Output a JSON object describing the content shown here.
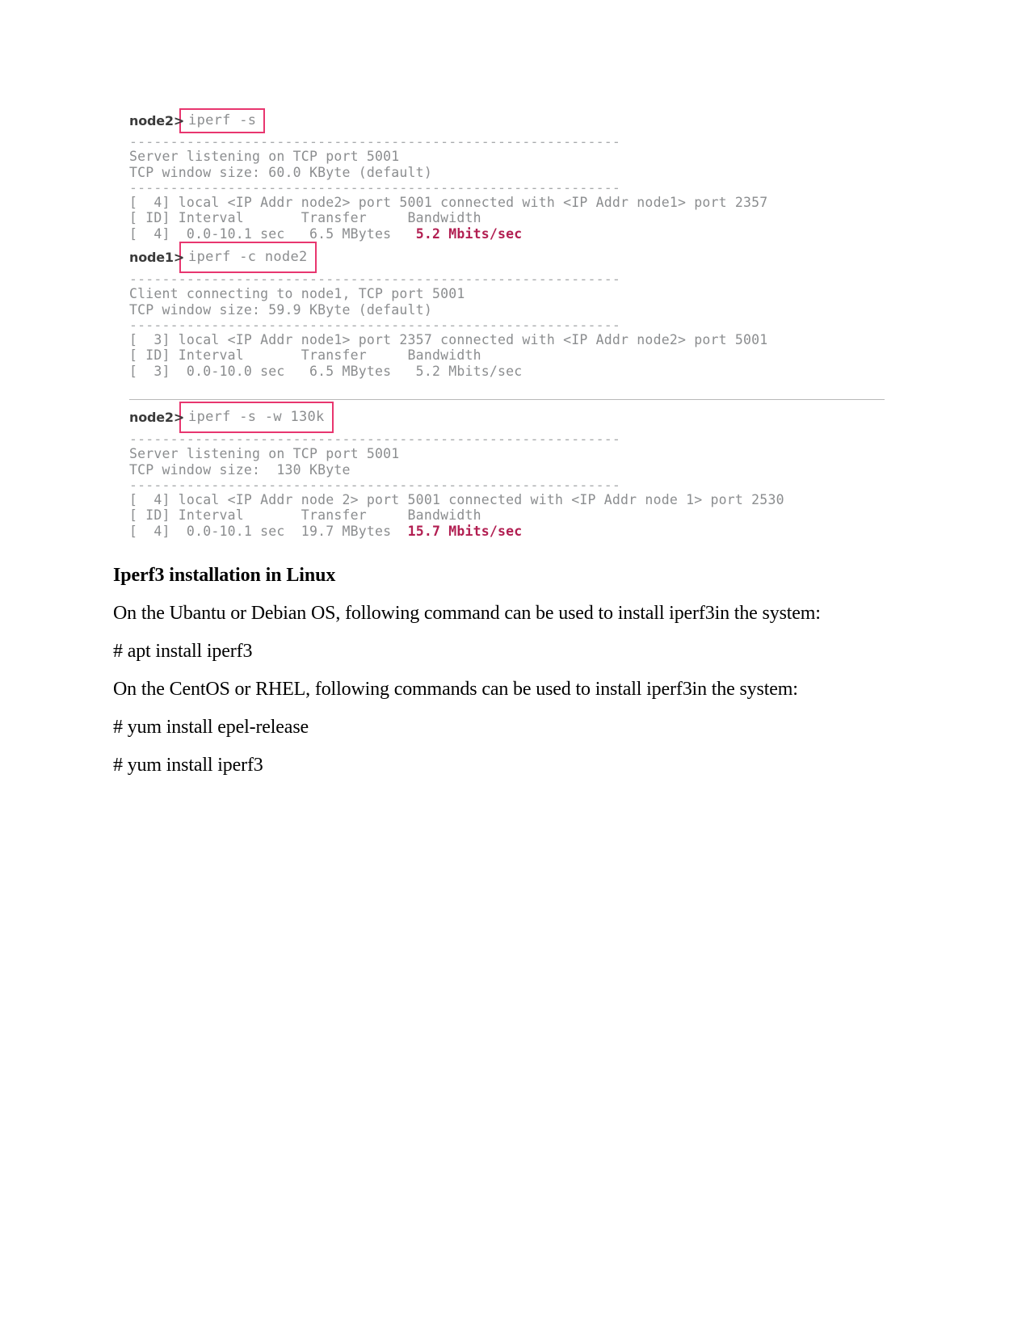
{
  "document": {
    "terminal": {
      "blocks": [
        {
          "prompt": "node2>",
          "command": "iperf -s",
          "lines": [
            "------------------------------------------------------------",
            "Server listening on TCP port 5001",
            "TCP window size: 60.0 KByte (default)",
            "------------------------------------------------------------",
            "[  4] local <IP Addr node2> port 5001 connected with <IP Addr node1> port 2357",
            "[ ID] Interval       Transfer     Bandwidth"
          ],
          "result": {
            "prefix": "[  4]  0.0-10.1 sec   6.5 MBytes   ",
            "highlight": "5.2 Mbits/sec"
          }
        },
        {
          "prompt": "node1>",
          "command": "iperf -c node2",
          "lines": [
            "------------------------------------------------------------",
            "Client connecting to node1, TCP port 5001",
            "TCP window size: 59.9 KByte (default)",
            "------------------------------------------------------------",
            "[  3] local <IP Addr node1> port 2357 connected with <IP Addr node2> port 5001",
            "[ ID] Interval       Transfer     Bandwidth"
          ],
          "result": {
            "prefix": "[  3]  0.0-10.0 sec   6.5 MBytes   5.2 Mbits/sec",
            "highlight": ""
          }
        },
        {
          "prompt": "node2>",
          "command": "iperf -s -w 130k",
          "lines": [
            "------------------------------------------------------------",
            "Server listening on TCP port 5001",
            "TCP window size:  130 KByte",
            "------------------------------------------------------------",
            "[  4] local <IP Addr node 2> port 5001 connected with <IP Addr node 1> port 2530",
            "[ ID] Interval       Transfer     Bandwidth"
          ],
          "result": {
            "prefix": "[  4]  0.0-10.1 sec  19.7 MBytes  ",
            "highlight": "15.7 Mbits/sec"
          }
        }
      ],
      "accent_color": "#e8366f",
      "highlight_color": "#b21f52",
      "text_color": "#8b8d8f"
    },
    "section": {
      "heading": "Iperf3 installation in Linux",
      "paragraphs": [
        "On the Ubantu or Debian OS, following command can be used to install iperf3in the system:",
        "# apt install iperf3",
        "On the CentOS or RHEL, following commands can be used to install iperf3in the system:",
        "# yum install epel-release",
        "# yum install iperf3"
      ]
    }
  }
}
